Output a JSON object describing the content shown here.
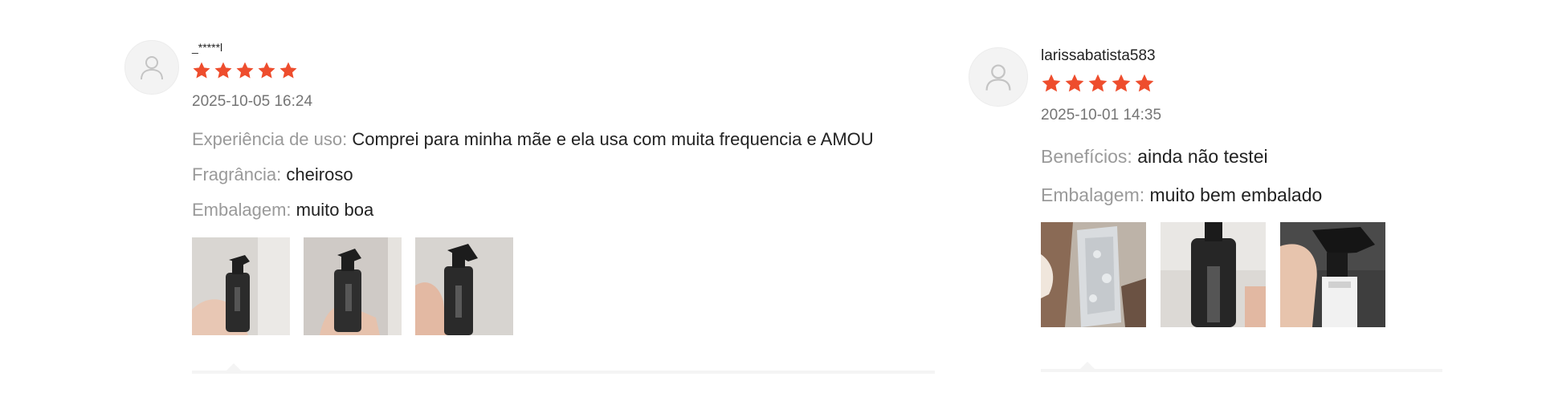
{
  "colors": {
    "star": "#ee4d2d",
    "label": "#9a9a9a",
    "text": "#222222",
    "date": "#757575"
  },
  "reviews": [
    {
      "username": "_*****l",
      "rating": 5,
      "date": "2025-10-05 16:24",
      "attributes": [
        {
          "label": "Experiência de uso:",
          "value": "Comprei para minha mãe e ela usa com muita frequencia e AMOU"
        },
        {
          "label": "Fragrância:",
          "value": "cheiroso"
        },
        {
          "label": "Embalagem:",
          "value": "muito boa"
        }
      ],
      "photos": [
        "product-photo-1",
        "product-photo-2",
        "product-photo-3"
      ]
    },
    {
      "username": "larissabatista583",
      "rating": 5,
      "date": "2025-10-01 14:35",
      "attributes": [
        {
          "label": "Benefícios:",
          "value": "ainda não testei"
        },
        {
          "label": "Embalagem:",
          "value": "muito bem embalado"
        }
      ],
      "photos": [
        "product-photo-1",
        "product-photo-2",
        "product-photo-3"
      ]
    }
  ]
}
